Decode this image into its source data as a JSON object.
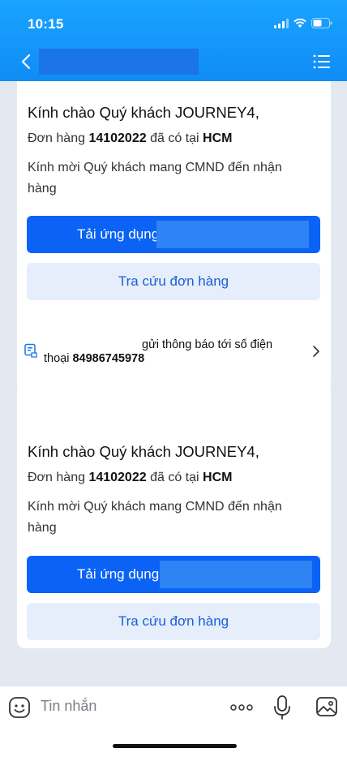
{
  "status_bar": {
    "time": "10:15"
  },
  "header": {
    "back_icon": "chevron-left-icon",
    "menu_icon": "list-menu-icon"
  },
  "messages": [
    {
      "greeting": "Kính chào Quý khách JOURNEY4,",
      "order_prefix": "Đơn hàng",
      "order_number": "14102022",
      "order_middle": "đã có tại",
      "order_location": "HCM",
      "invite_text": "Kính mời Quý khách mang CMND đến nhận hàng",
      "primary_button": "Tải ứng dụng",
      "secondary_button": "Tra cứu đơn hàng"
    },
    {
      "greeting": "Kính chào Quý khách JOURNEY4,",
      "order_prefix": "Đơn hàng",
      "order_number": "14102022",
      "order_middle": "đã có tại",
      "order_location": "HCM",
      "invite_text": "Kính mời Quý khách mang CMND đến nhận hàng",
      "primary_button": "Tải ứng dụng",
      "primary_button_suffix": "",
      "secondary_button": "Tra cứu đơn hàng"
    }
  ],
  "notice": {
    "line1": "gửi thông báo tới số điện",
    "line2_prefix": "thoại",
    "phone": "84986745978"
  },
  "composer": {
    "placeholder": "Tin nhắn"
  },
  "colors": {
    "header": "#0f8cf6",
    "primary_button": "#0a63f5",
    "secondary_button_bg": "#e6eefb",
    "secondary_button_text": "#1a5fd6",
    "chat_bg": "#e4e8f0"
  }
}
